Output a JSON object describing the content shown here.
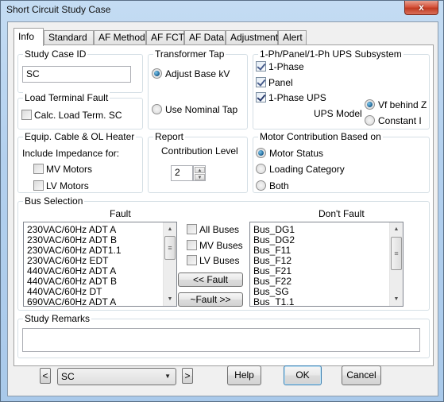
{
  "window": {
    "title": "Short Circuit Study Case",
    "close_label": "x"
  },
  "tabs": [
    {
      "label": "Info",
      "active": true
    },
    {
      "label": "Standard",
      "active": false
    },
    {
      "label": "AF Method",
      "active": false
    },
    {
      "label": "AF FCT",
      "active": false
    },
    {
      "label": "AF Data",
      "active": false
    },
    {
      "label": "Adjustment",
      "active": false
    },
    {
      "label": "Alert",
      "active": false
    }
  ],
  "study_case_id": {
    "label": "Study Case ID",
    "value": "SC"
  },
  "load_terminal_fault": {
    "label": "Load Terminal Fault",
    "calc_label": "Calc. Load Term. SC",
    "calc_checked": false
  },
  "transformer_tap": {
    "label": "Transformer Tap",
    "options": [
      {
        "label": "Adjust Base kV",
        "selected": true
      },
      {
        "label": "Use Nominal Tap",
        "selected": false
      }
    ]
  },
  "subsystem": {
    "label": "1-Ph/Panel/1-Ph UPS Subsystem",
    "checks": [
      {
        "label": "1-Phase",
        "checked": true
      },
      {
        "label": "Panel",
        "checked": true
      },
      {
        "label": "1-Phase UPS",
        "checked": true
      }
    ],
    "ups_model_label": "UPS Model",
    "ups_options": [
      {
        "label": "Vf behind Z",
        "selected": true
      },
      {
        "label": "Constant I",
        "selected": false
      }
    ]
  },
  "equip_cable": {
    "label": "Equip. Cable & OL Heater",
    "include_label": "Include Impedance for:",
    "checks": [
      {
        "label": "MV Motors",
        "checked": false
      },
      {
        "label": "LV Motors",
        "checked": false
      }
    ]
  },
  "report": {
    "label": "Report",
    "contribution_label": "Contribution Level",
    "contribution_value": "2",
    "spin_up": "▲",
    "spin_down": "▼"
  },
  "motor_contribution": {
    "label": "Motor Contribution Based on",
    "options": [
      {
        "label": "Motor Status",
        "selected": true
      },
      {
        "label": "Loading Category",
        "selected": false
      },
      {
        "label": "Both",
        "selected": false
      }
    ]
  },
  "bus_selection": {
    "label": "Bus Selection",
    "fault_header": "Fault",
    "dont_fault_header": "Don't Fault",
    "fault_items": [
      "230VAC/60Hz ADT A",
      "230VAC/60Hz ADT B",
      "230VAC/60Hz ADT1.1",
      "230VAC/60Hz EDT",
      "440VAC/60Hz ADT A",
      "440VAC/60Hz ADT B",
      "440VAC/60Hz DT",
      "690VAC/60Hz ADT A"
    ],
    "dont_fault_items": [
      "Bus_DG1",
      "Bus_DG2",
      "Bus_F11",
      "Bus_F12",
      "Bus_F21",
      "Bus_F22",
      "Bus_SG",
      "Bus_T1.1"
    ],
    "checks": [
      {
        "label": "All Buses",
        "checked": false
      },
      {
        "label": "MV Buses",
        "checked": false
      },
      {
        "label": "LV Buses",
        "checked": false
      }
    ],
    "to_fault_label": "<< Fault",
    "to_dont_fault_label": "~Fault >>",
    "scroll_up": "▲",
    "scroll_down": "▼",
    "thumb_grip": "≡"
  },
  "study_remarks": {
    "label": "Study Remarks",
    "value": ""
  },
  "footer": {
    "prev_label": "<",
    "next_label": ">",
    "case_select_value": "SC",
    "case_select_arrow": "▼",
    "help_label": "Help",
    "ok_label": "OK",
    "cancel_label": "Cancel"
  }
}
